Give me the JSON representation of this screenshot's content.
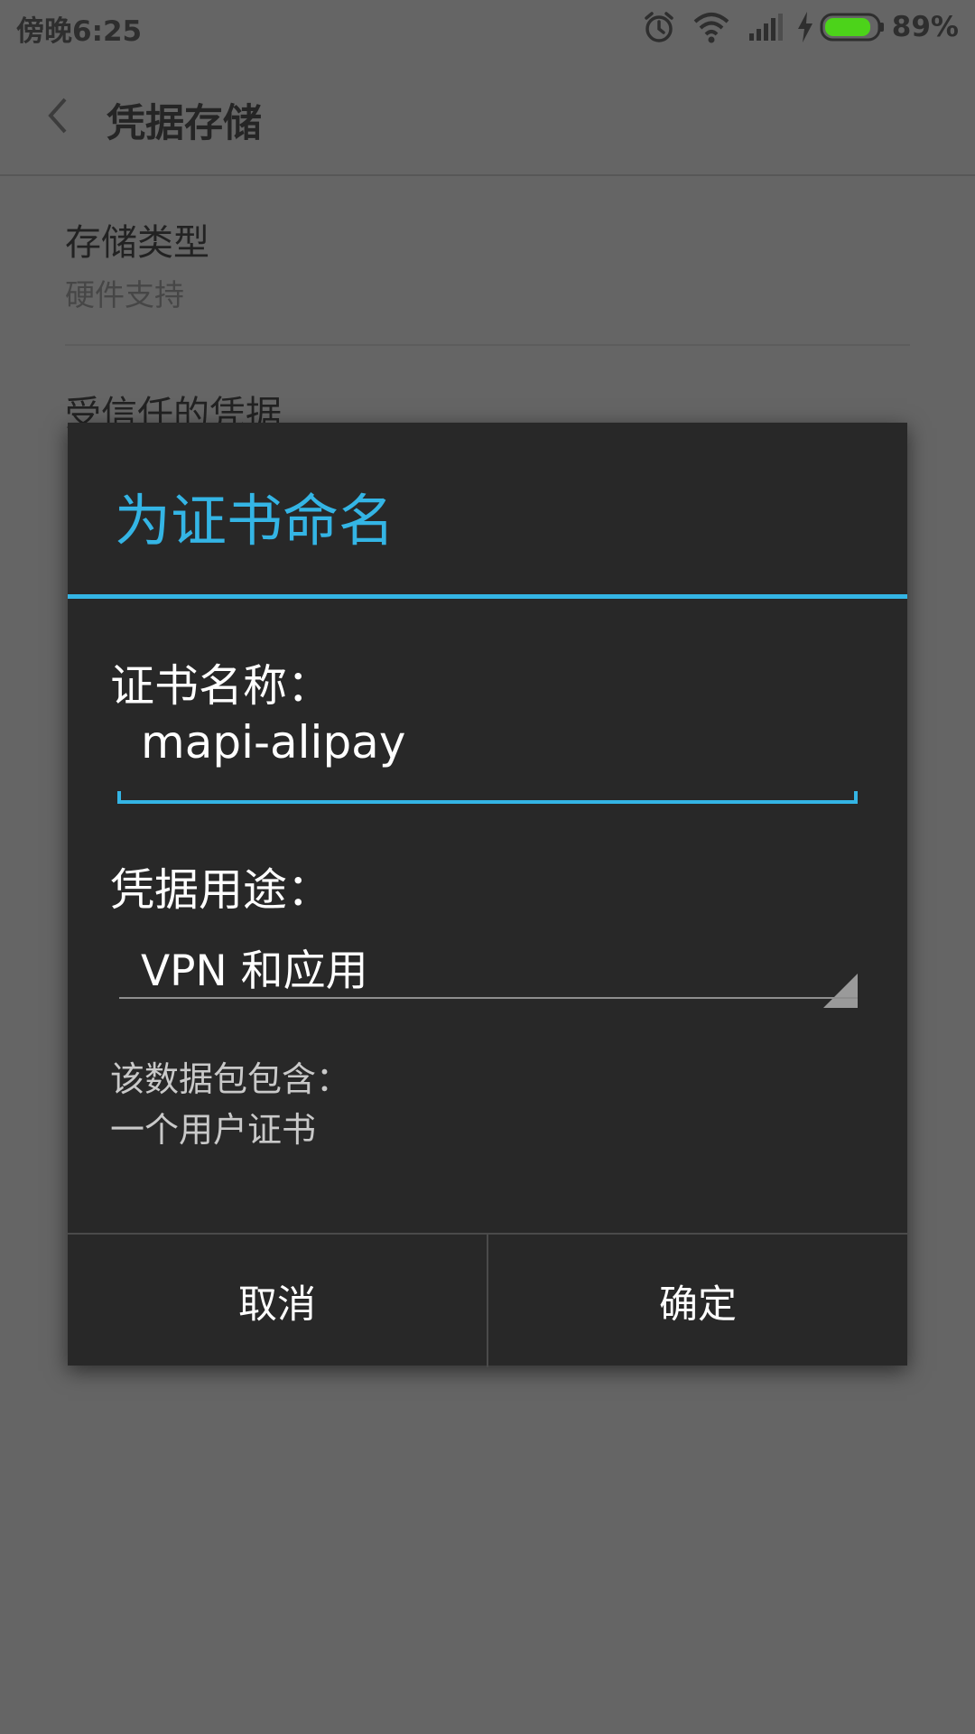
{
  "status_bar": {
    "time": "傍晚6:25",
    "battery_percent": "89%",
    "battery_level": 0.89,
    "icons": [
      "alarm-icon",
      "wifi-icon",
      "signal-icon",
      "charging-icon",
      "battery-icon"
    ],
    "battery_color": "#4cd31a"
  },
  "app_bar": {
    "title": "凭据存储",
    "back_icon": "chevron-left-icon"
  },
  "settings": {
    "items": [
      {
        "title": "存储类型",
        "subtitle": "硬件支持"
      },
      {
        "title": "受信任的凭据"
      }
    ]
  },
  "dialog": {
    "title": "为证书命名",
    "accent_color": "#34b5e5",
    "name_label": "证书名称：",
    "name_value": "mapi-alipay",
    "usage_label": "凭据用途：",
    "usage_value": "VPN 和应用",
    "info_line1": "该数据包包含：",
    "info_line2": "一个用户证书",
    "cancel_label": "取消",
    "ok_label": "确定"
  }
}
